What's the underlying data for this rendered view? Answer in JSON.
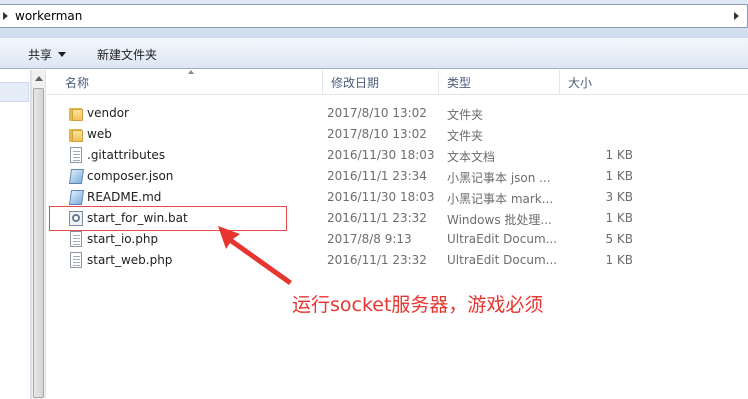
{
  "address": {
    "path": "workerman"
  },
  "toolbar": {
    "share_label": "共享",
    "new_folder_label": "新建文件夹"
  },
  "columns": {
    "name": "名称",
    "date": "修改日期",
    "type": "类型",
    "size": "大小"
  },
  "files": [
    {
      "icon": "folder-icon",
      "name": "vendor",
      "date": "2017/8/10 13:02",
      "type": "文件夹",
      "size": ""
    },
    {
      "icon": "folder-icon",
      "name": "web",
      "date": "2017/8/10 13:02",
      "type": "文件夹",
      "size": ""
    },
    {
      "icon": "text-document-icon",
      "name": ".gitattributes",
      "date": "2016/11/30 18:03",
      "type": "文本文档",
      "size": "1 KB"
    },
    {
      "icon": "notepad-file-icon",
      "name": "composer.json",
      "date": "2016/11/1 23:34",
      "type": "小黑记事本 json ...",
      "size": "1 KB"
    },
    {
      "icon": "notepad-file-icon",
      "name": "README.md",
      "date": "2016/11/30 18:03",
      "type": "小黑记事本 mark...",
      "size": "3 KB"
    },
    {
      "icon": "batch-file-icon",
      "name": "start_for_win.bat",
      "date": "2016/11/1 23:32",
      "type": "Windows 批处理...",
      "size": "1 KB"
    },
    {
      "icon": "text-document-icon",
      "name": "start_io.php",
      "date": "2017/8/8 9:13",
      "type": "UltraEdit Docum...",
      "size": "5 KB"
    },
    {
      "icon": "text-document-icon",
      "name": "start_web.php",
      "date": "2016/11/1 23:32",
      "type": "UltraEdit Docum...",
      "size": "1 KB"
    }
  ],
  "annotation": {
    "text": "运行socket服务器，游戏必须",
    "color": "#e8352f",
    "highlighted_file": "start_for_win.bat"
  },
  "colors": {
    "header_text": "#4c607a",
    "meta_text": "#6d6d6d",
    "toolbar_bg": "#dce6f4"
  }
}
